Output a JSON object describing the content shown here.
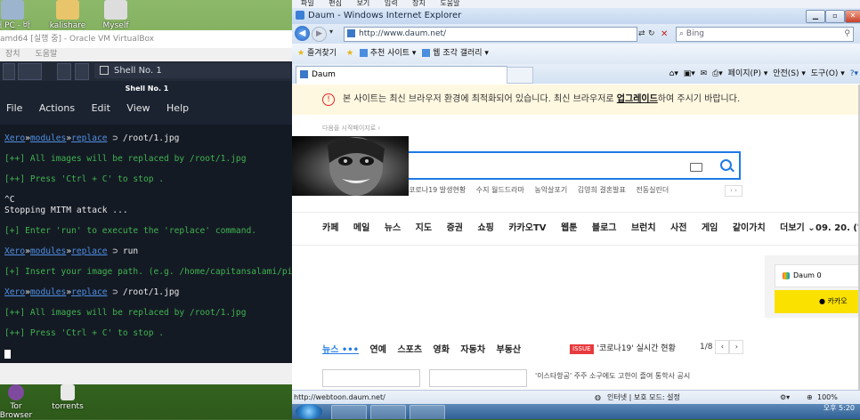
{
  "desktop": {
    "top_icons": [
      {
        "label": "내 PC - 바로\n가기",
        "icon": "computer-icon"
      },
      {
        "label": "kalishare",
        "icon": "folder-icon"
      },
      {
        "label": "Myself",
        "icon": "user-icon"
      }
    ],
    "bottom_icons": [
      {
        "label": "Tor Browser",
        "icon": "tor-icon"
      },
      {
        "label": "torrents",
        "icon": "folder-icon"
      }
    ]
  },
  "vbox": {
    "title": "amd64 [실행 중] - Oracle VM VirtualBox",
    "menu": [
      "장치",
      "도움말"
    ]
  },
  "guest": {
    "tab_label": "Shell No. 1",
    "terminal_title": "Shell No. 1",
    "menu": [
      "File",
      "Actions",
      "Edit",
      "View",
      "Help"
    ],
    "lines": [
      {
        "kind": "prompt",
        "module": "replace",
        "arg": "/root/1.jpg"
      },
      {
        "kind": "info",
        "text": "[++] All images will be replaced by /root/1.jpg"
      },
      {
        "kind": "info",
        "text": "[++] Press 'Ctrl + C' to stop ."
      },
      {
        "kind": "plain",
        "text": "^C"
      },
      {
        "kind": "plain",
        "text": "Stopping MITM attack ..."
      },
      {
        "kind": "info",
        "text": "[+] Enter 'run' to execute the 'replace' command."
      },
      {
        "kind": "prompt",
        "module": "replace",
        "arg": "run"
      },
      {
        "kind": "info",
        "text": "[+] Insert your image path. (e.g. /home/capitansalami/pi"
      },
      {
        "kind": "prompt",
        "module": "replace",
        "arg": "/root/1.jpg"
      },
      {
        "kind": "info",
        "text": "[++] All images will be replaced by /root/1.jpg"
      },
      {
        "kind": "info",
        "text": "[++] Press 'Ctrl + C' to stop ."
      }
    ],
    "prompt_parts": {
      "xero": "Xero",
      "sep": "»",
      "modules": "modules",
      "arrow": "⊃"
    }
  },
  "host_menu": [
    "파일",
    "편집",
    "보기",
    "입력",
    "장치",
    "도움말"
  ],
  "ie": {
    "title": "Daum - Windows Internet Explorer",
    "url": "http://www.daum.net/",
    "search_placeholder": "Bing",
    "favorites_label": "즐겨찾기",
    "fav_links": [
      "추천 사이트 ▾",
      "웹 조각 갤러리 ▾"
    ],
    "tab_title": "Daum",
    "cmd_items": [
      "페이지(P) ▾",
      "안전(S) ▾",
      "도구(O) ▾"
    ],
    "status_url": "http://webtoon.daum.net/",
    "status_zone": "인터넷 | 보호 모드: 설정",
    "zoom": "100%",
    "clock": "오후 5:20"
  },
  "daum": {
    "notice": "본 사이트는 최신 브라우저 환경에 최적화되어 있습니다. 최신 브라우저로 ",
    "notice_link": "업그레이드",
    "notice_tail": "하여 주시기 바랍니다.",
    "start_page": "다음을 시작페이지로 ›",
    "trends": [
      "코로나19 발생현황",
      "수지 월드드라마",
      "농악살포기",
      "김영희 결혼발표",
      "전동실린더"
    ],
    "nav": [
      "카페",
      "메일",
      "뉴스",
      "지도",
      "증권",
      "쇼핑",
      "카카오TV",
      "웹툰",
      "블로그",
      "브런치",
      "사전",
      "게임",
      "같이가치",
      "더보기 ⌄"
    ],
    "date": "09. 20. (일",
    "daum_login": "Daum 0",
    "kakao_login": "카카오",
    "news_tabs": [
      "뉴스 •••",
      "연예",
      "스포츠",
      "영화",
      "자동차",
      "부동산"
    ],
    "issue_badge": "ISSUE",
    "issue_text": "'코로나19' 실시간 현황",
    "issue_page": "1/8",
    "stub_text": "'이스타항공' 주주 소구에도 고한이 즐여 통학사 공시"
  },
  "colors": {
    "terminal_bg": "#141a24",
    "prompt_blue": "#4f8fe3",
    "info_green": "#3fb34f",
    "daum_blue": "#1e7ae6",
    "kakao_yellow": "#fae100"
  }
}
